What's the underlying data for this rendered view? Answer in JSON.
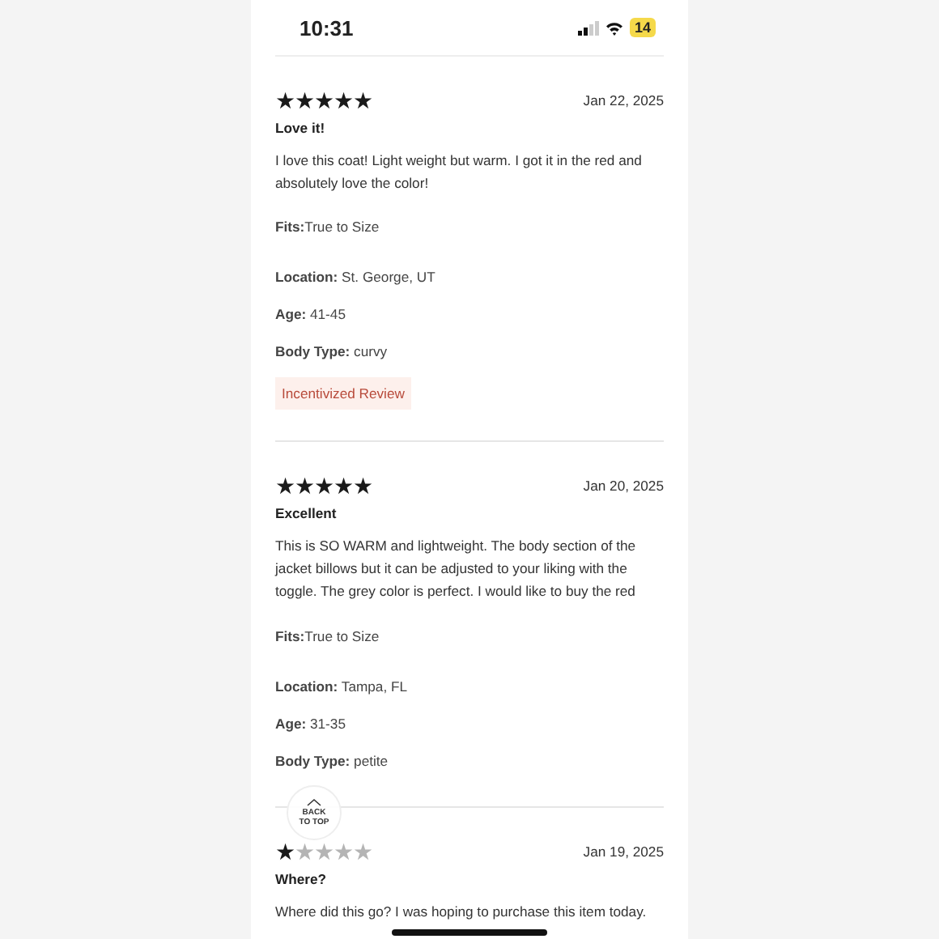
{
  "status_bar": {
    "time": "10:31",
    "battery": "14"
  },
  "reviews": [
    {
      "stars": 5,
      "date": "Jan 22, 2025",
      "title": "Love it!",
      "body": "I love this coat! Light weight but warm. I got it in the red and absolutely love the color!",
      "fits_label": "Fits:",
      "fits": "True to Size",
      "details": [
        {
          "label": "Location:",
          "value": "St. George, UT"
        },
        {
          "label": "Age:",
          "value": "41-45"
        },
        {
          "label": "Body Type:",
          "value": "curvy"
        }
      ],
      "badge": "Incentivized Review"
    },
    {
      "stars": 5,
      "date": "Jan 20, 2025",
      "title": "Excellent",
      "body": "This is SO WARM and lightweight. The body section of the jacket billows but it can be adjusted to your liking with the toggle. The grey color is perfect. I would like to buy the red",
      "fits_label": "Fits:",
      "fits": "True to Size",
      "details": [
        {
          "label": "Location:",
          "value": "Tampa, FL"
        },
        {
          "label": "Age:",
          "value": "31-35"
        },
        {
          "label": "Body Type:",
          "value": "petite"
        }
      ]
    },
    {
      "stars": 1,
      "date": "Jan 19, 2025",
      "title": "Where?",
      "body": "Where did this go? I was hoping to purchase this item today."
    }
  ],
  "back_to_top": {
    "label": "BACK TO TOP"
  }
}
